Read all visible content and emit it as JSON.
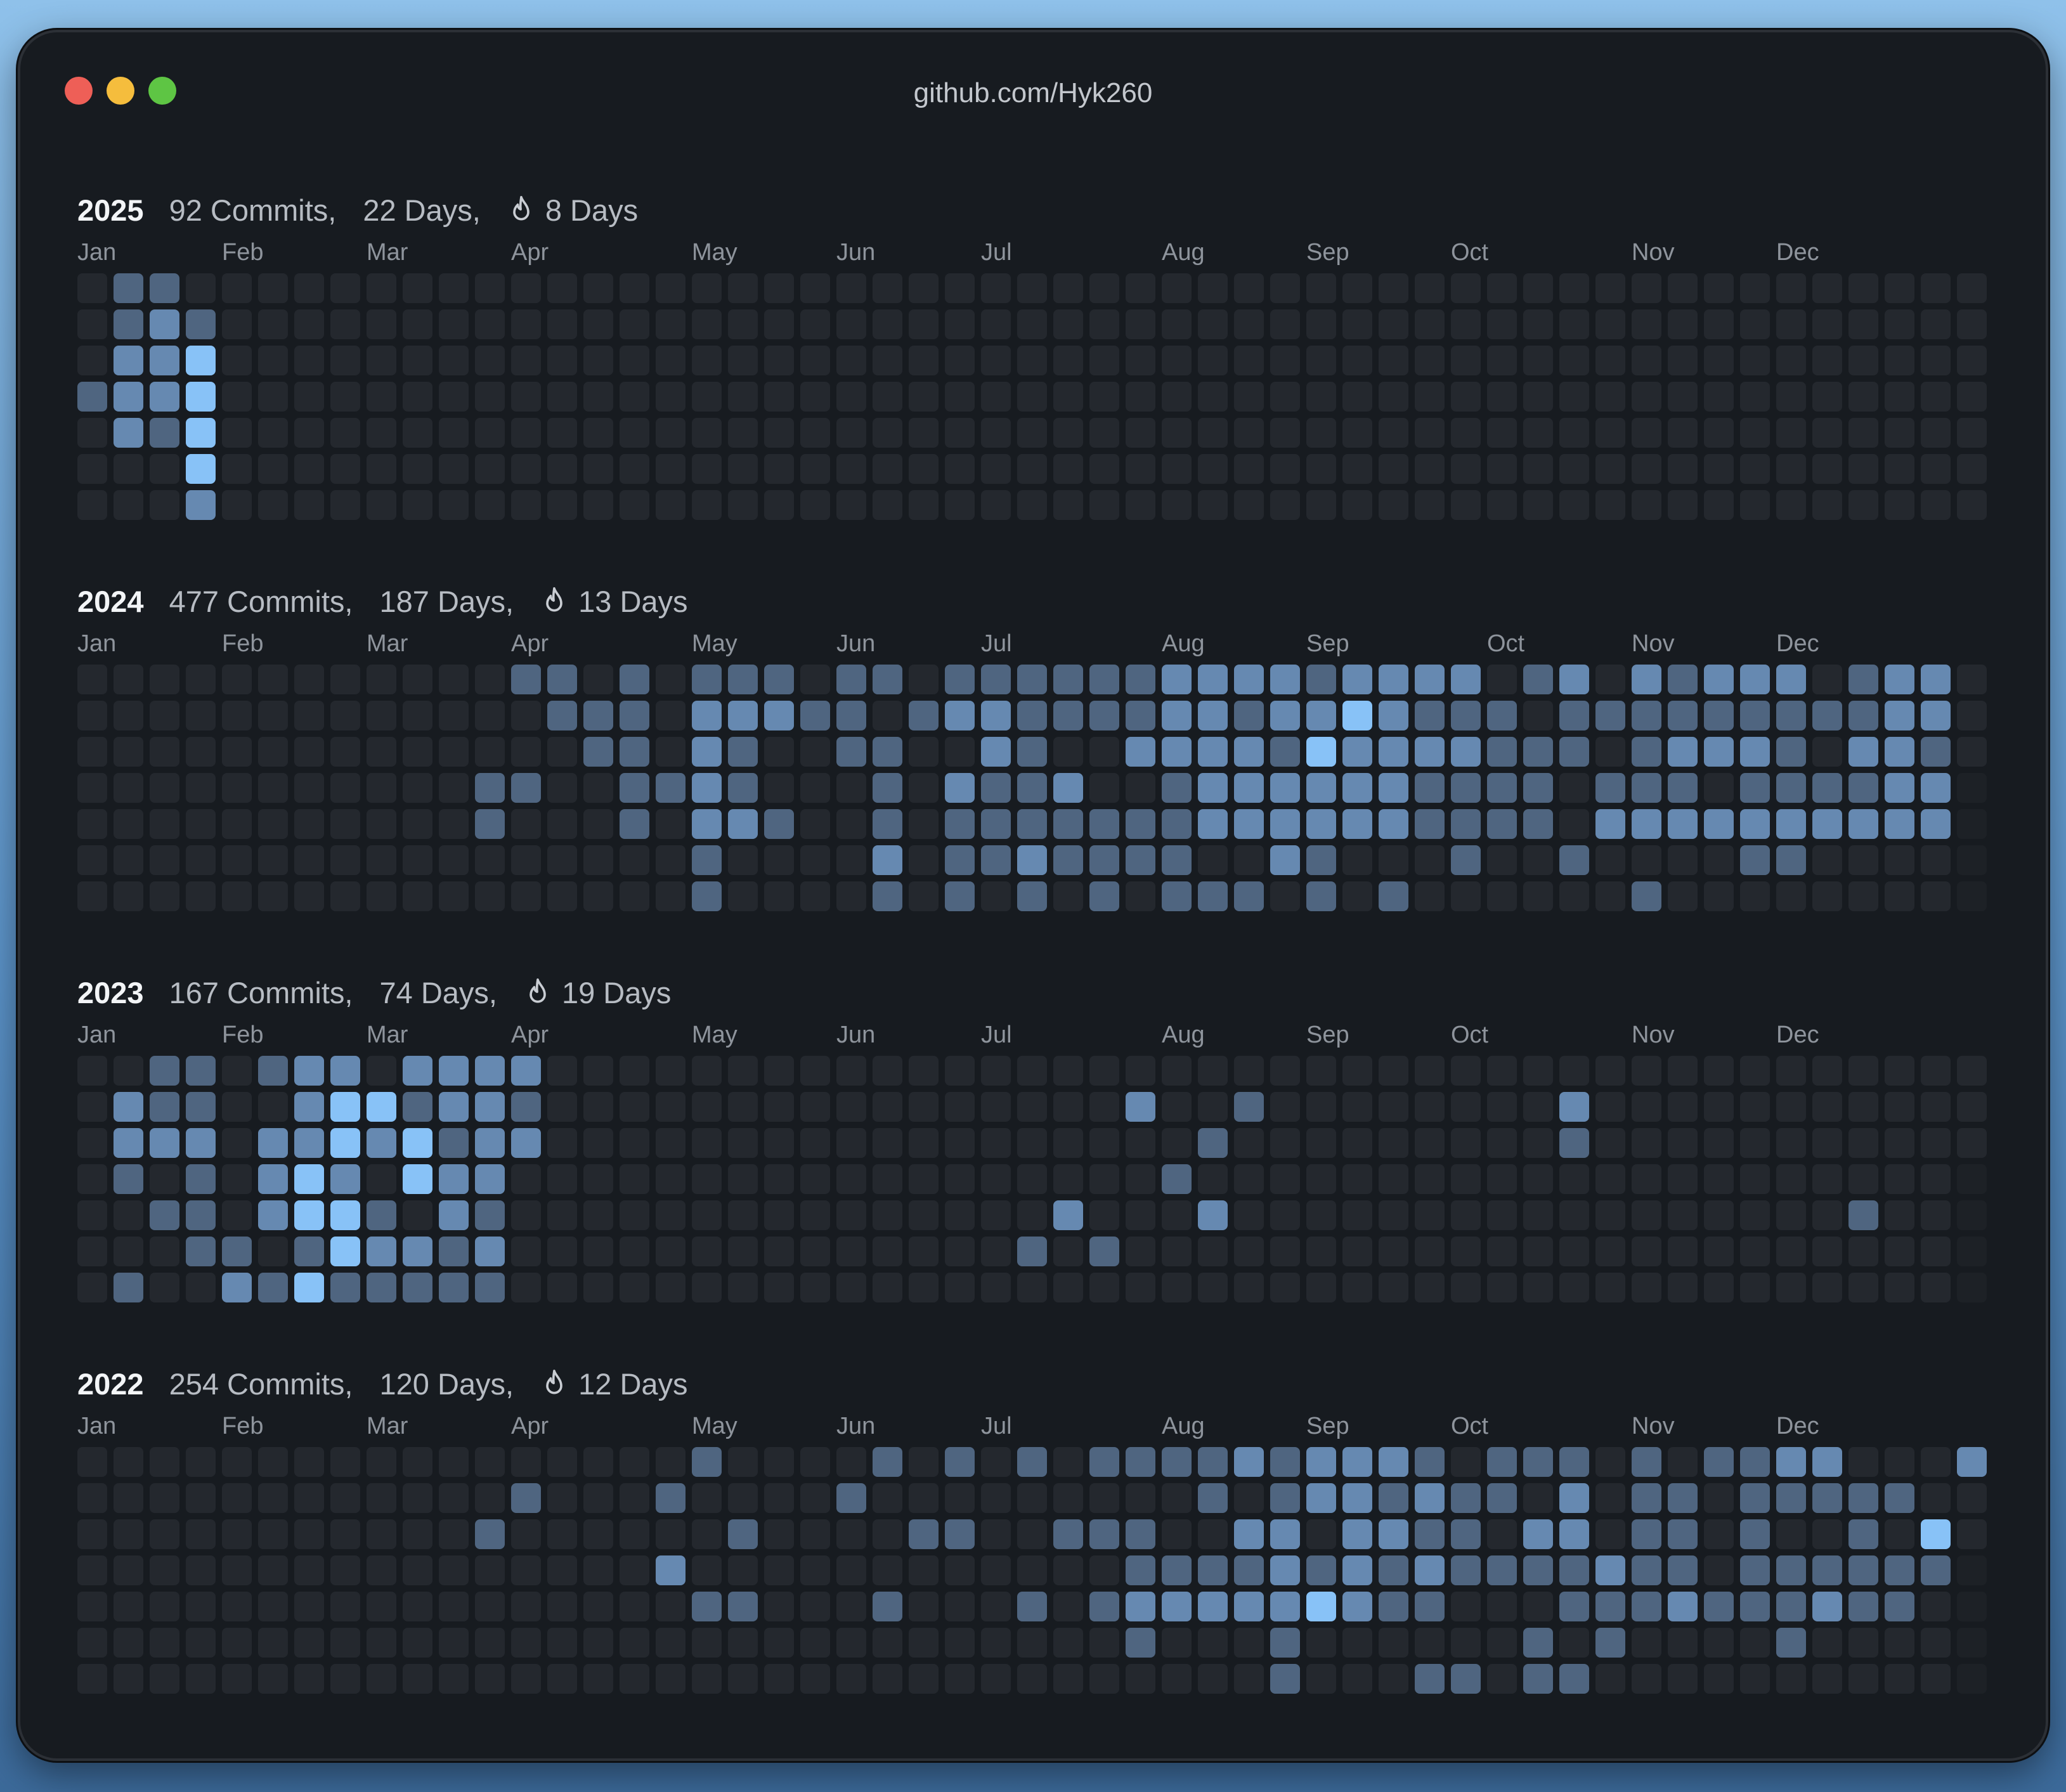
{
  "window": {
    "title": "github.com/Hyk260"
  },
  "months": [
    "Jan",
    "Feb",
    "Mar",
    "Apr",
    "May",
    "Jun",
    "Jul",
    "Aug",
    "Sep",
    "Oct",
    "Nov",
    "Dec"
  ],
  "colors": {
    "empty": "#24282e",
    "future": "#1d2126",
    "level1": "#3e4f64",
    "level2": "#4f6580",
    "level3": "#6689b1",
    "level4": "#88c2f7"
  },
  "years": [
    {
      "year": "2025",
      "commits": "92 Commits,",
      "days": "22 Days,",
      "streak": "8 Days",
      "month_cols": [
        0,
        4,
        8,
        12,
        17,
        21,
        25,
        30,
        34,
        38,
        43,
        47
      ],
      "grid": [
        "0220000000000000000000000000000000000000000000000000",
        "0232000000000000000000000000000000000000000000000000",
        "0334000000000000000000000000000000000000000000000000",
        "2334000000000000000000000000000000000000000000000000",
        "0324000000000000000000000000000000000000000000000000",
        "0004000000000000000000000000000000000000000000000000",
        "0003000000000000000000000000000000000000000000000000"
      ]
    },
    {
      "year": "2024",
      "commits": "477 Commits,",
      "days": "187 Days,",
      "streak": "13 Days",
      "month_cols": [
        0,
        4,
        8,
        12,
        17,
        21,
        25,
        30,
        34,
        39,
        43,
        47
      ],
      "grid": [
        "00000000000022020222022022222233332333302303233302330",
        "00000000000002220333220233222233233432220222222222330",
        "00000000000000220320022003200333324333322202333203320",
        "00000000000220022320002032230023333332222022202222330",
        "00000000000200020332002022222223333332222033333333330",
        "00000000000000000200003022322220032000200200002200000",
        "00000000000000000200002020202022202020000002000000000"
      ]
    },
    {
      "year": "2023",
      "commits": "167 Commits,",
      "days": "74 Days,",
      "streak": "19 Days",
      "month_cols": [
        0,
        4,
        8,
        12,
        17,
        21,
        25,
        30,
        34,
        38,
        43,
        47
      ],
      "grid": [
        "00220233033330000000000000000000000000000000000000000",
        "03220034423320000000000000000000000000000000000000000",
        "03330334342330000000000000000000000000000000000000000",
        "02020343043300000000000000000000000000000000000000000",
        "00220344203200000000000000000000000000000000000000000",
        "00022024332300000000000000000000000000000000000000000",
        "02003242222200000000000000000000000000000000000000000"
      ],
      "extra": [
        [
          1,
          29,
          3
        ],
        [
          1,
          32,
          2
        ],
        [
          1,
          41,
          3
        ],
        [
          2,
          31,
          2
        ],
        [
          2,
          41,
          2
        ],
        [
          3,
          30,
          2
        ],
        [
          4,
          27,
          3
        ],
        [
          4,
          31,
          3
        ],
        [
          4,
          49,
          2
        ],
        [
          5,
          26,
          2
        ],
        [
          5,
          28,
          2
        ]
      ]
    },
    {
      "year": "2022",
      "commits": "254 Commits,",
      "days": "120 Days,",
      "streak": "12 Days",
      "month_cols": [
        0,
        4,
        8,
        12,
        17,
        21,
        25,
        30,
        34,
        38,
        43,
        47
      ],
      "grid": [
        "00000000000000000200002020202222323332022202022330003",
        "00000000000020002000020000000002023323220302202222200",
        "00000000000200000020000220022200330332203302202002040",
        "00000000000000003000000000000222232323222232202222220",
        "00000000000000000220002000202333334322000222322232200",
        "00000000000000000000000000000000000000000000000000000",
        "00000000000000000000000000000000000000000000000000000"
      ],
      "extra": [
        [
          5,
          29,
          2
        ],
        [
          5,
          33,
          2
        ],
        [
          5,
          40,
          2
        ],
        [
          5,
          42,
          2
        ],
        [
          5,
          47,
          2
        ],
        [
          6,
          33,
          2
        ],
        [
          6,
          37,
          2
        ],
        [
          6,
          38,
          2
        ],
        [
          6,
          40,
          2
        ],
        [
          6,
          41,
          2
        ]
      ]
    }
  ]
}
